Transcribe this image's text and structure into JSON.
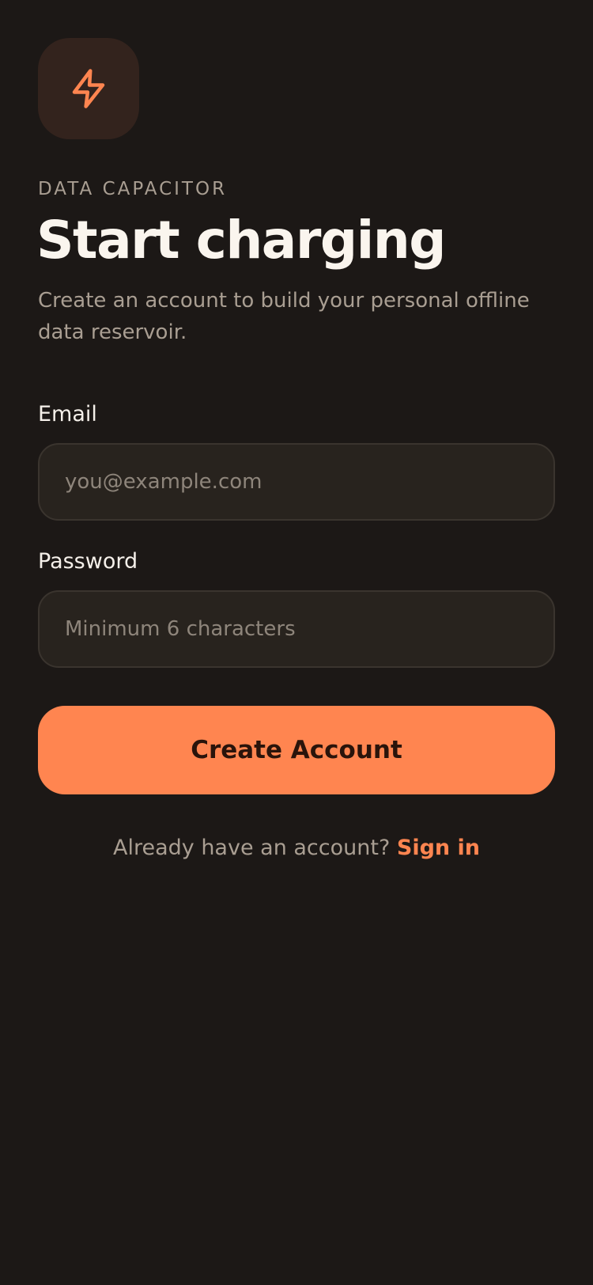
{
  "brand": {
    "overline": "DATA CAPACITOR",
    "logo_icon": "lightning-bolt-icon",
    "accent_color": "#ff8550"
  },
  "header": {
    "title": "Start charging",
    "subtitle": "Create an account to build your personal offline data reservoir."
  },
  "form": {
    "email": {
      "label": "Email",
      "placeholder": "you@example.com",
      "value": ""
    },
    "password": {
      "label": "Password",
      "placeholder": "Minimum 6 characters",
      "value": ""
    },
    "submit_label": "Create Account"
  },
  "footer": {
    "prompt": "Already have an account?",
    "link_label": "Sign in"
  }
}
